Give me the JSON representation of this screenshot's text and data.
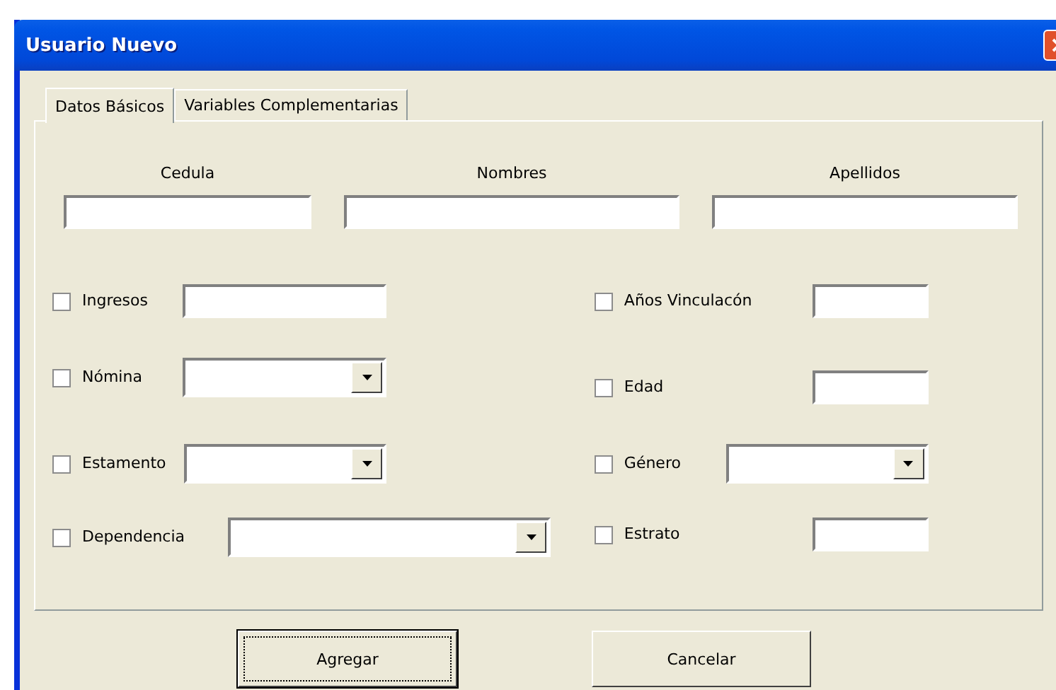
{
  "window": {
    "title": "Usuario Nuevo"
  },
  "tabs": [
    {
      "label": "Datos Básicos",
      "selected": true
    },
    {
      "label": "Variables Complementarias",
      "selected": false
    }
  ],
  "header_fields": [
    {
      "label": "Cedula"
    },
    {
      "label": "Nombres"
    },
    {
      "label": "Apellidos"
    }
  ],
  "left_fields": [
    {
      "label": "Ingresos",
      "checked": false,
      "kind": "text"
    },
    {
      "label": "Nómina",
      "checked": false,
      "kind": "combo"
    },
    {
      "label": "Estamento",
      "checked": false,
      "kind": "combo"
    },
    {
      "label": "Dependencia",
      "checked": false,
      "kind": "combo"
    }
  ],
  "right_fields": [
    {
      "label": "Años Vinculacón",
      "checked": false,
      "kind": "text"
    },
    {
      "label": "Edad",
      "checked": false,
      "kind": "text"
    },
    {
      "label": "Género",
      "checked": false,
      "kind": "combo"
    },
    {
      "label": "Estrato",
      "checked": false,
      "kind": "text"
    }
  ],
  "buttons": [
    {
      "label": "Agregar",
      "focused": true
    },
    {
      "label": "Cancelar",
      "focused": false
    }
  ]
}
